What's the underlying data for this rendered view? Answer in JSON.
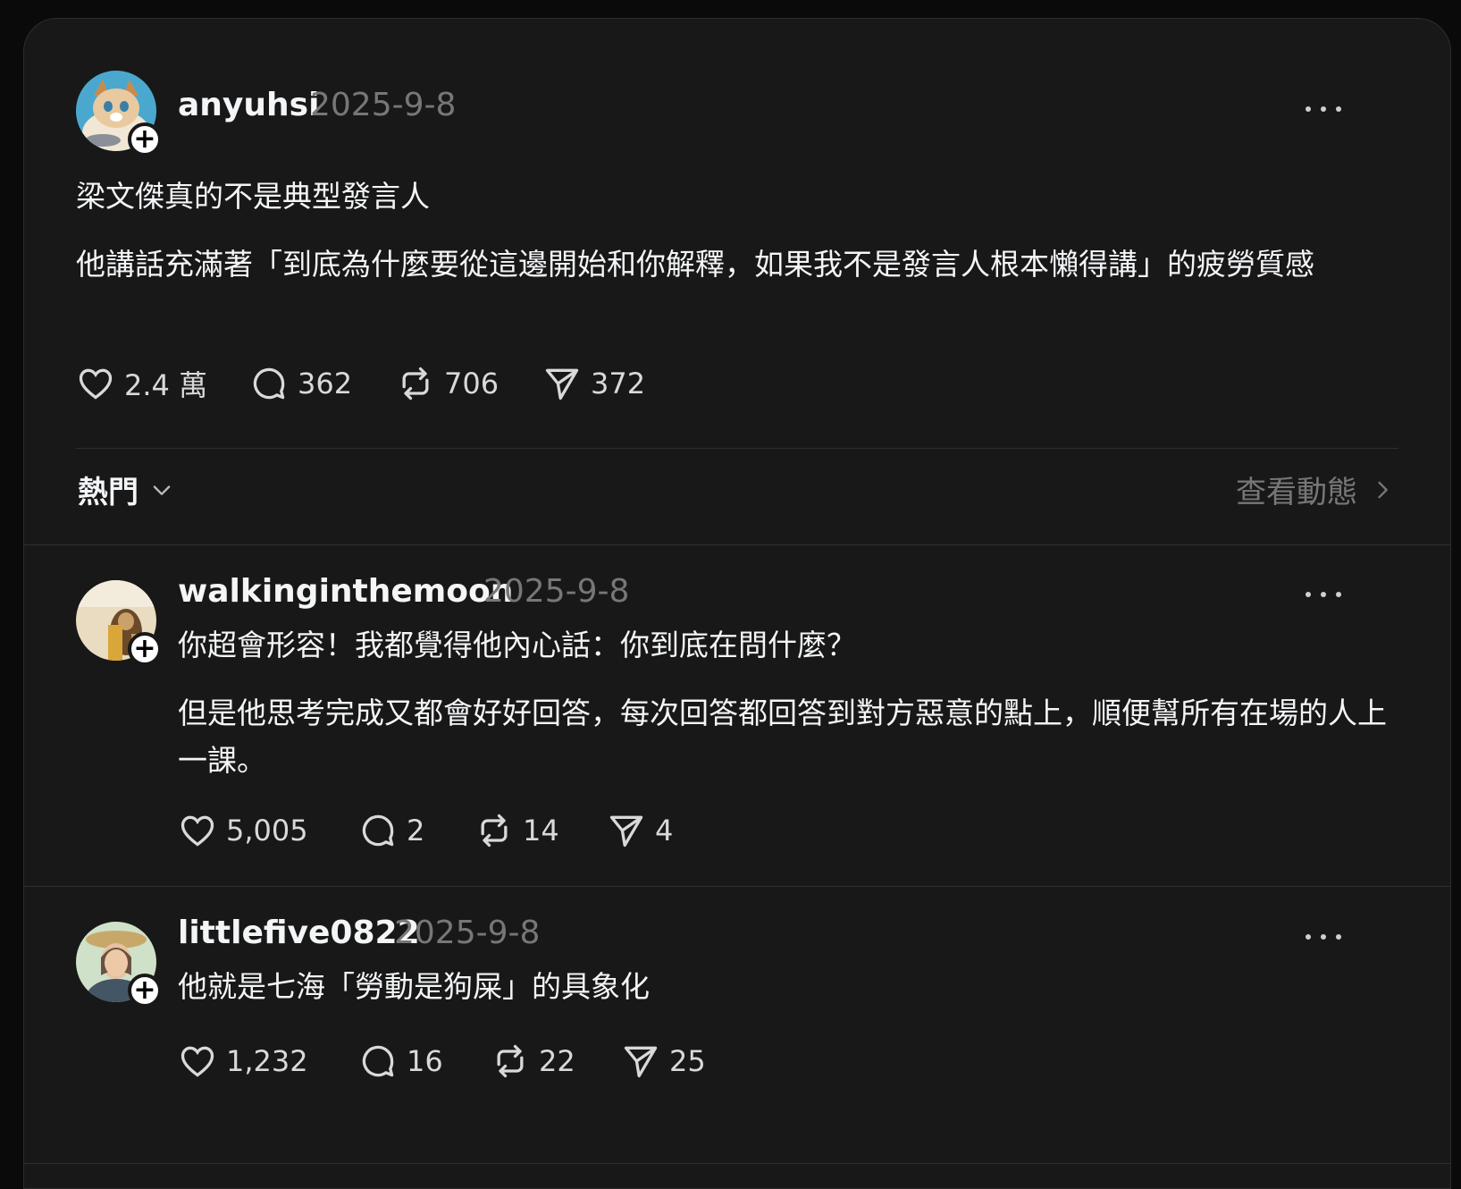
{
  "post": {
    "username": "anyuhsi",
    "date": "2025-9-8",
    "lines": [
      "梁文傑真的不是典型發言人",
      "他講話充滿著「到底為什麼要從這邊開始和你解釋，如果我不是發言人根本懶得講」的疲勞質感"
    ],
    "likes": "2.4 萬",
    "comments": "362",
    "reposts": "706",
    "shares": "372"
  },
  "filter": {
    "sort_label": "熱門",
    "activity_label": "查看動態"
  },
  "replies": [
    {
      "username": "walkinginthemoon",
      "date": "2025-9-8",
      "lines": [
        "你超會形容！我都覺得他內心話：你到底在問什麼？",
        "但是他思考完成又都會好好回答，每次回答都回答到對方惡意的點上，順便幫所有在場的人上一課。"
      ],
      "likes": "5,005",
      "comments": "2",
      "reposts": "14",
      "shares": "4"
    },
    {
      "username": "littlefive0822",
      "date": "2025-9-8",
      "lines": [
        "他就是七海「勞動是狗屎」的具象化"
      ],
      "likes": "1,232",
      "comments": "16",
      "reposts": "22",
      "shares": "25"
    }
  ],
  "icons": {
    "like": "heart-icon",
    "comment": "comment-bubble-icon",
    "repost": "repost-icon",
    "share": "send-icon",
    "more": "more-dots-icon",
    "follow": "plus-icon"
  }
}
